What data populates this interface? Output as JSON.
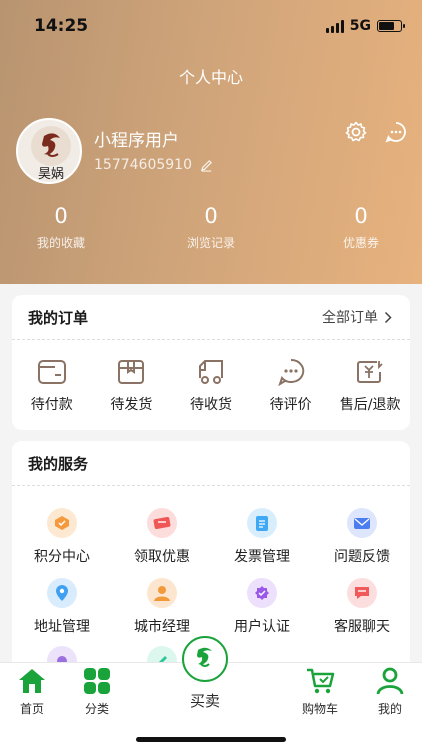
{
  "status_bar": {
    "time": "14:25",
    "network": "5G",
    "battery_level": 0.7
  },
  "header": {
    "title": "个人中心"
  },
  "profile": {
    "avatar_text": "昊娲",
    "username": "小程序用户",
    "phone": "15774605910",
    "icons": [
      "settings-icon",
      "message-icon",
      "edit-icon"
    ]
  },
  "stats": [
    {
      "value": "0",
      "label": "我的收藏"
    },
    {
      "value": "0",
      "label": "浏览记录"
    },
    {
      "value": "0",
      "label": "优惠券"
    }
  ],
  "orders": {
    "title": "我的订单",
    "all_label": "全部订单",
    "items": [
      {
        "label": "待付款",
        "icon": "wallet-icon"
      },
      {
        "label": "待发货",
        "icon": "box-icon"
      },
      {
        "label": "待收货",
        "icon": "truck-icon"
      },
      {
        "label": "待评价",
        "icon": "comment-icon"
      },
      {
        "label": "售后/退款",
        "icon": "refund-icon"
      }
    ]
  },
  "services": {
    "title": "我的服务",
    "items": [
      {
        "label": "积分中心",
        "icon": "points-icon",
        "color": "#f59a3c"
      },
      {
        "label": "领取优惠",
        "icon": "coupon-icon",
        "color": "#f05656"
      },
      {
        "label": "发票管理",
        "icon": "invoice-icon",
        "color": "#3fa9f5"
      },
      {
        "label": "问题反馈",
        "icon": "feedback-icon",
        "color": "#4a7df0"
      },
      {
        "label": "地址管理",
        "icon": "location-icon",
        "color": "#3fa0f2"
      },
      {
        "label": "城市经理",
        "icon": "manager-icon",
        "color": "#f29a3a"
      },
      {
        "label": "用户认证",
        "icon": "verify-icon",
        "color": "#9b59e8"
      },
      {
        "label": "客服聊天",
        "icon": "chat-icon",
        "color": "#f05a5a"
      }
    ]
  },
  "tabbar": {
    "items": [
      {
        "label": "首页",
        "icon": "home-icon"
      },
      {
        "label": "分类",
        "icon": "category-icon"
      },
      {
        "label": "买卖",
        "icon": "trade-logo-icon"
      },
      {
        "label": "购物车",
        "icon": "cart-icon"
      },
      {
        "label": "我的",
        "icon": "profile-icon"
      }
    ],
    "accent": "#1aa33a"
  }
}
